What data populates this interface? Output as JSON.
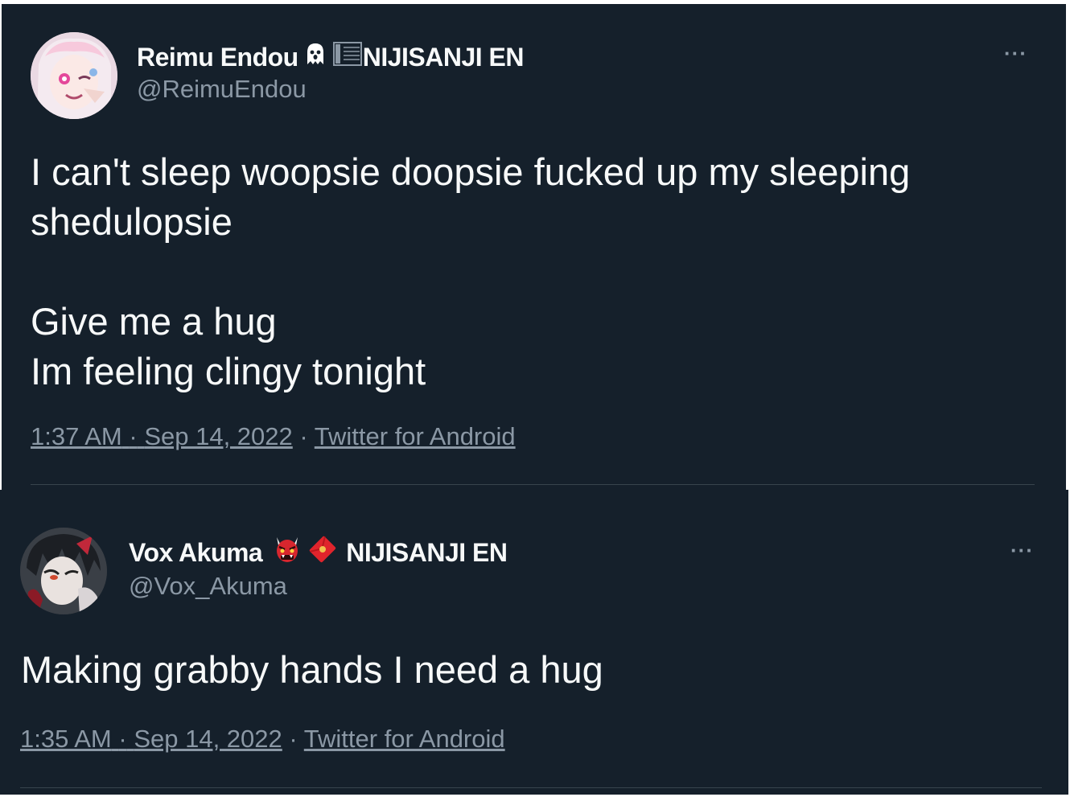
{
  "tweets": [
    {
      "author_name": "Reimu Endou",
      "badge_icons": [
        "ghost-icon",
        "flag-icon"
      ],
      "affiliation": "NIJISANJI EN",
      "handle": "@ReimuEndou",
      "more": "···",
      "body": "I can't sleep woopsie doopsie fucked up my sleeping shedulopsie\n\nGive me a hug\nIm feeling clingy tonight",
      "time": "1:37 AM",
      "date": "Sep 14, 2022",
      "source": "Twitter for Android",
      "dot": "·"
    },
    {
      "author_name": "Vox Akuma",
      "badge_icons": [
        "ogre-icon",
        "red-envelope-icon"
      ],
      "affiliation": "NIJISANJI EN",
      "handle": "@Vox_Akuma",
      "more": "···",
      "body": "Making grabby hands I need a hug",
      "time": "1:35 AM",
      "date": "Sep 14, 2022",
      "source": "Twitter for Android",
      "dot": "·"
    }
  ],
  "colors": {
    "background": "#15202b",
    "text": "#f7f9f9",
    "secondary_text": "#8b98a5",
    "divider": "#38444d"
  }
}
